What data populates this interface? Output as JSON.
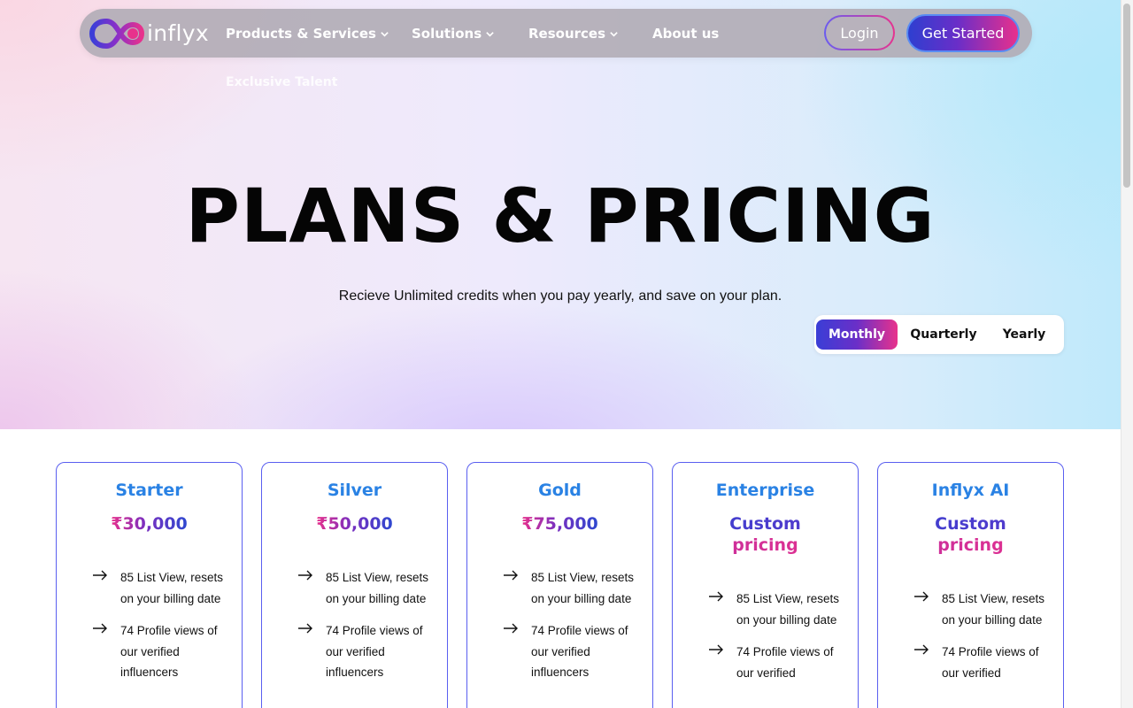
{
  "brand": {
    "name": "inflyx"
  },
  "nav": {
    "items": [
      {
        "label": "Products & Services",
        "has_dropdown": true
      },
      {
        "label": "Solutions",
        "has_dropdown": true
      },
      {
        "label": "Resources",
        "has_dropdown": true
      },
      {
        "label": "About us",
        "has_dropdown": false
      }
    ],
    "submenu_peek": "Exclusive Talent",
    "login_label": "Login",
    "cta_label": "Get Started"
  },
  "hero": {
    "title": "PLANS & PRICING",
    "subtitle": "Recieve Unlimited credits when you pay yearly, and save on your plan."
  },
  "billing_toggle": {
    "options": [
      "Monthly",
      "Quarterly",
      "Yearly"
    ],
    "selected": "Monthly"
  },
  "plans": [
    {
      "name": "Starter",
      "price": "₹30,000",
      "features": [
        "85 List View, resets on your billing date",
        "74 Profile views of our verified influencers"
      ]
    },
    {
      "name": "Silver",
      "price": "₹50,000",
      "features": [
        "85 List View, resets on your billing date",
        "74 Profile views of our verified influencers"
      ]
    },
    {
      "name": "Gold",
      "price": "₹75,000",
      "features": [
        "85 List View, resets on your billing date",
        "74 Profile views of our verified influencers"
      ]
    },
    {
      "name": "Enterprise",
      "price_line1": "Custom",
      "price_line2": "pricing",
      "features": [
        "85 List View, resets on your billing date",
        "74 Profile views of our verified"
      ]
    },
    {
      "name": "Inflyx AI",
      "price_line1": "Custom",
      "price_line2": "pricing",
      "features": [
        "85 List View, resets on your billing date",
        "74 Profile views of our verified"
      ]
    }
  ],
  "colors": {
    "plan_name": "#2a82e4",
    "card_border": "#5a5ff0",
    "gradient_start": "#3a3ed6",
    "gradient_end": "#e8328c"
  }
}
